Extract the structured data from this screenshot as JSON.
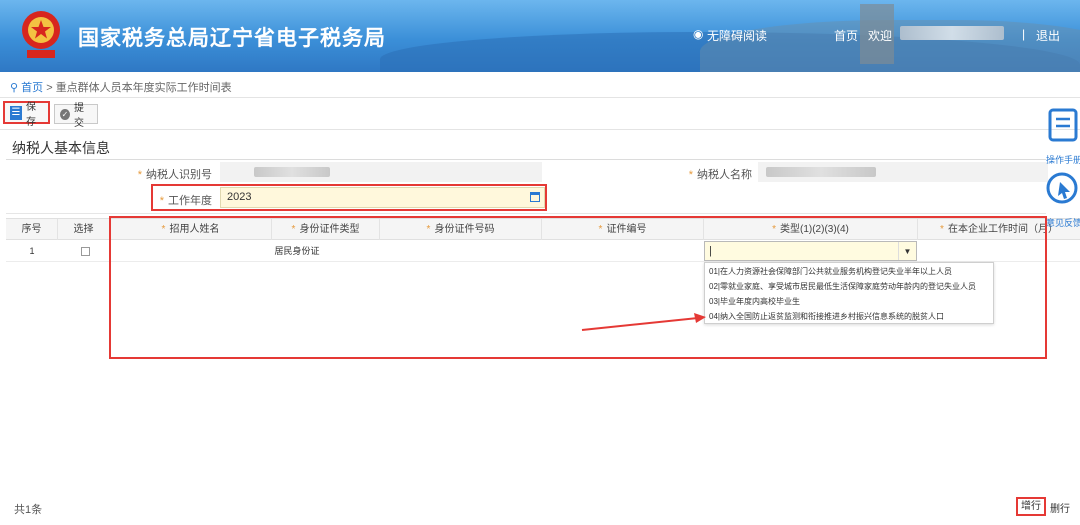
{
  "header": {
    "title": "国家税务总局辽宁省电子税务局",
    "accessibility": "无障碍阅读",
    "home": "首页",
    "welcome": "欢迎",
    "separator": "|",
    "logout": "退出"
  },
  "breadcrumb": {
    "home": "首页",
    "sep": ">",
    "current": "重点群体人员本年度实际工作时间表"
  },
  "toolbar": {
    "save_label": "保存",
    "submit_label": "提交"
  },
  "section": {
    "title": "纳税人基本信息"
  },
  "form": {
    "taxpayer_id_label": "纳税人识别号",
    "taxpayer_name_label": "纳税人名称",
    "work_year_label": "工作年度",
    "work_year_value": "2023"
  },
  "grid": {
    "headers": [
      "序号",
      "选择",
      "招用人姓名",
      "身份证件类型",
      "身份证件号码",
      "证件编号",
      "类型(1)(2)(3)(4)",
      "在本企业工作时间（月）"
    ],
    "rows": [
      {
        "index": "1",
        "name": "",
        "id_type": "居民身份证",
        "id_number": "",
        "cert_no": "",
        "type": "|",
        "months": ""
      }
    ]
  },
  "dropdown": {
    "options": [
      "01|在人力资源社会保障部门公共就业服务机构登记失业半年以上人员",
      "02|零就业家庭、享受城市居民最低生活保障家庭劳动年龄内的登记失业人员",
      "03|毕业年度内高校毕业生",
      "04|纳入全国防止返贫监测和衔接推进乡村振兴信息系统的脱贫人口"
    ]
  },
  "side": {
    "manual_label": "操作手册",
    "feedback_label": "意见反馈"
  },
  "footer": {
    "total": "共1条",
    "add_row": "增行",
    "delete_row": "删行"
  },
  "colors": {
    "header_blue": "#3b8fd8",
    "highlight_red": "#e53935",
    "required_orange": "#e69a3c",
    "input_yellow": "#fff8dc"
  }
}
